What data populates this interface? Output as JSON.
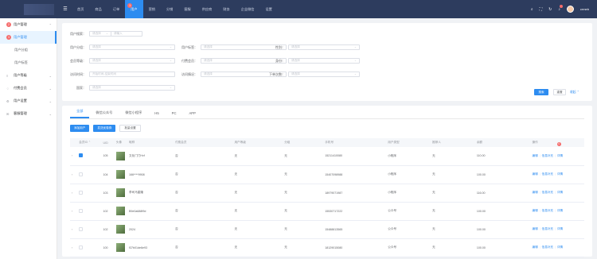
{
  "nav": {
    "items": [
      "首页",
      "商品",
      "订单",
      "用户",
      "营销",
      "分销",
      "客服",
      "供应商",
      "财务",
      "企业微信",
      "设置"
    ],
    "active_index": 3,
    "badge": "1"
  },
  "header_tools": {
    "user_name": "crmeb",
    "icons": [
      "search-icon",
      "fullscreen-icon",
      "refresh-icon",
      "notification-icon"
    ]
  },
  "sidebar": {
    "groups": [
      {
        "label": "用户管理",
        "icon": "user-icon",
        "mark": "2",
        "open": true,
        "children": [
          {
            "label": "用户管理",
            "mark": "3",
            "active": true
          },
          {
            "label": "用户分组"
          },
          {
            "label": "用户标签"
          }
        ]
      },
      {
        "label": "用户等级",
        "icon": "level-icon"
      },
      {
        "label": "付费会员",
        "icon": "vip-icon"
      },
      {
        "label": "用户设置",
        "icon": "settings-icon"
      },
      {
        "label": "客服管理",
        "icon": "service-icon"
      }
    ]
  },
  "filter": {
    "search_label": "用户搜索：",
    "search_select": "请选择",
    "search_placeholder": "请输入",
    "rows": [
      [
        "用户分组：",
        "请选择",
        "用户标签：",
        "请选择",
        "性别：",
        "请选择"
      ],
      [
        "会员等级：",
        "请选择",
        "付费会员：",
        "请选择",
        "身份：",
        "请选择"
      ],
      [
        "访问时间：",
        "开始时间-结束时间",
        "访问情况：",
        "请选择",
        "下单次数：",
        "请选择"
      ],
      [
        "国家：",
        "请选择"
      ]
    ],
    "search_button": "搜索",
    "reset_button": "重置",
    "collapse_label": "收起"
  },
  "tabs": [
    "全部",
    "微信公众号",
    "微信小程序",
    "H5",
    "PC",
    "APP"
  ],
  "actions": [
    "添加用户",
    "发送优惠券",
    "批量设置"
  ],
  "table": {
    "columns": [
      "会员ID",
      "UID",
      "头像",
      "昵称",
      "付费会员",
      "用户等级",
      "分组",
      "手机号",
      "用户类型",
      "推荐人",
      "余额",
      "操作"
    ],
    "rows": [
      {
        "checked": true,
        "uid": "105",
        "name": "文化门门Hvf",
        "vip": "否",
        "level": "无",
        "group": "无",
        "phone": "15211410080",
        "type": "小程序",
        "ref": "无",
        "balance": "110.00"
      },
      {
        "checked": false,
        "uid": "104",
        "name": "166****9908",
        "vip": "否",
        "level": "无",
        "group": "无",
        "phone": "15407098988",
        "type": "小程序",
        "ref": "无",
        "balance": "100.00"
      },
      {
        "checked": false,
        "uid": "103",
        "name": "李司马星隆",
        "vip": "否",
        "level": "无",
        "group": "无",
        "phone": "18979071987",
        "type": "小程序",
        "ref": "无",
        "balance": "116.00"
      },
      {
        "checked": false,
        "uid": "102",
        "name": "B9e0a688f9d",
        "vip": "否",
        "level": "无",
        "group": "无",
        "phone": "15530717222",
        "type": "公众号",
        "ref": "无",
        "balance": "100.00"
      },
      {
        "checked": false,
        "uid": "102",
        "name": "2024",
        "vip": "否",
        "level": "无",
        "group": "无",
        "phone": "15488813565",
        "type": "公众号",
        "ref": "无",
        "balance": "100.00"
      },
      {
        "checked": false,
        "uid": "100",
        "name": "f37b01de6e93",
        "vip": "否",
        "level": "无",
        "group": "无",
        "phone": "18129015080",
        "type": "公众号",
        "ref": "无",
        "balance": "100.00"
      }
    ],
    "ops": {
      "edit": "编辑",
      "info": "信息补充",
      "more": "详情"
    },
    "ops_badge": "4"
  }
}
